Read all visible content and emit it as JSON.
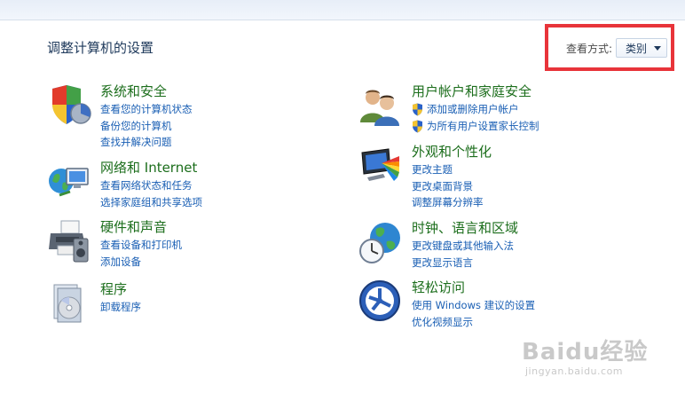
{
  "header": {
    "title": "调整计算机的设置",
    "view_by_label": "查看方式:",
    "view_by_value": "类别"
  },
  "categories": [
    {
      "title": "系统和安全",
      "icon": "shield-computer-icon",
      "links": [
        "查看您的计算机状态",
        "备份您的计算机",
        "查找并解决问题"
      ]
    },
    {
      "title": "网络和 Internet",
      "icon": "network-globe-icon",
      "links": [
        "查看网络状态和任务",
        "选择家庭组和共享选项"
      ]
    },
    {
      "title": "硬件和声音",
      "icon": "printer-speaker-icon",
      "links": [
        "查看设备和打印机",
        "添加设备"
      ]
    },
    {
      "title": "程序",
      "icon": "programs-disc-icon",
      "links": [
        "卸载程序"
      ]
    },
    {
      "title": "用户帐户和家庭安全",
      "icon": "users-icon",
      "links": [
        "添加或删除用户帐户",
        "为所有用户设置家长控制"
      ]
    },
    {
      "title": "外观和个性化",
      "icon": "display-color-icon",
      "links": [
        "更改主题",
        "更改桌面背景",
        "调整屏幕分辨率"
      ]
    },
    {
      "title": "时钟、语言和区域",
      "icon": "clock-globe-icon",
      "links": [
        "更改键盘或其他输入法",
        "更改显示语言"
      ]
    },
    {
      "title": "轻松访问",
      "icon": "ease-of-access-icon",
      "links": [
        "使用 Windows 建议的设置",
        "优化视频显示"
      ]
    }
  ],
  "watermark": {
    "logo": "Baidu经验",
    "url": "jingyan.baidu.com"
  },
  "colors": {
    "category_title": "#1c6e1c",
    "link": "#1a5fb4",
    "page_title": "#1e395b",
    "highlight_box": "#e8343a"
  }
}
